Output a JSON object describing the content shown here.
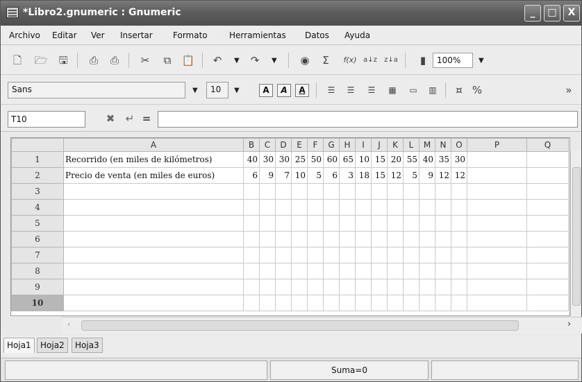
{
  "window": {
    "title": "*Libro2.gnumeric : Gnumeric",
    "btn_min": "_",
    "btn_max": "□",
    "btn_close": "X"
  },
  "menu": [
    "Archivo",
    "Editar",
    "Ver",
    "Insertar",
    "Formato",
    "Herramientas",
    "Datos",
    "Ayuda"
  ],
  "toolbar": {
    "zoom": "100%",
    "sum_icon": "Σ",
    "fx_icon": "f(x)",
    "overflow": "»"
  },
  "format": {
    "font": "Sans",
    "size": "10",
    "bold": "A",
    "italic": "A",
    "underline": "A"
  },
  "formula": {
    "cellref": "T10",
    "equals": "="
  },
  "columns": [
    "A",
    "B",
    "C",
    "D",
    "E",
    "F",
    "G",
    "H",
    "I",
    "J",
    "K",
    "L",
    "M",
    "N",
    "O",
    "P",
    "Q"
  ],
  "rows": [
    {
      "num": "1",
      "label": "Recorrido (en miles de kilómetros)",
      "values": [
        "40",
        "30",
        "30",
        "25",
        "50",
        "60",
        "65",
        "10",
        "15",
        "20",
        "55",
        "40",
        "35",
        "30"
      ]
    },
    {
      "num": "2",
      "label": "Precio de venta (en miles de euros)",
      "values": [
        "6",
        "9",
        "7",
        "10",
        "5",
        "6",
        "3",
        "18",
        "15",
        "12",
        "5",
        "9",
        "12",
        "12"
      ]
    },
    {
      "num": "3",
      "label": "",
      "values": []
    },
    {
      "num": "4",
      "label": "",
      "values": []
    },
    {
      "num": "5",
      "label": "",
      "values": []
    },
    {
      "num": "6",
      "label": "",
      "values": []
    },
    {
      "num": "7",
      "label": "",
      "values": []
    },
    {
      "num": "8",
      "label": "",
      "values": []
    },
    {
      "num": "9",
      "label": "",
      "values": []
    },
    {
      "num": "10",
      "label": "",
      "values": [],
      "selected": true
    }
  ],
  "sheets": [
    "Hoja1",
    "Hoja2",
    "Hoja3"
  ],
  "status": {
    "sum": "Suma=0"
  }
}
